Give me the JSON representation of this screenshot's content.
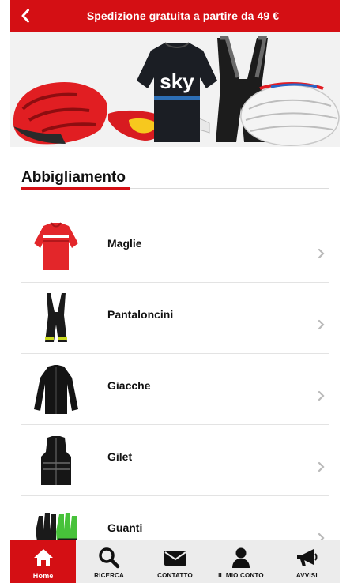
{
  "header": {
    "title": "Spedizione gratuita a partire da 49 €",
    "back_icon": "chevron-left-icon"
  },
  "banner": {
    "logo_text": "sky"
  },
  "section": {
    "title": "Abbigliamento"
  },
  "categories": [
    {
      "label": "Maglie",
      "icon": "jersey-icon"
    },
    {
      "label": "Pantaloncini",
      "icon": "bib-shorts-icon"
    },
    {
      "label": "Giacche",
      "icon": "jacket-icon"
    },
    {
      "label": "Gilet",
      "icon": "vest-icon"
    },
    {
      "label": "Guanti",
      "icon": "gloves-icon"
    }
  ],
  "tabs": [
    {
      "label": "Home",
      "icon": "home-icon",
      "active": true
    },
    {
      "label": "RICERCA",
      "icon": "search-icon",
      "active": false
    },
    {
      "label": "CONTATTO",
      "icon": "envelope-icon",
      "active": false
    },
    {
      "label": "IL MIO CONTO",
      "icon": "user-icon",
      "active": false
    },
    {
      "label": "AVVISI",
      "icon": "megaphone-icon",
      "active": false
    }
  ],
  "colors": {
    "accent": "#d40f14",
    "tabbar": "#ececec",
    "text": "#111111"
  }
}
